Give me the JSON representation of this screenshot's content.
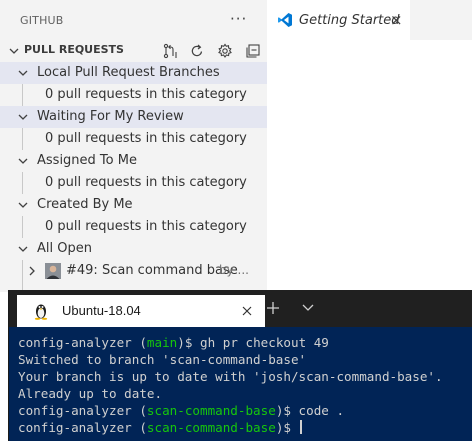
{
  "sidebar": {
    "header": "GITHUB",
    "more_label": "···",
    "section": {
      "title": "PULL REQUESTS",
      "icons": [
        "create-pull-request-icon",
        "refresh-icon",
        "settings-gear-icon",
        "collapse-all-icon"
      ]
    },
    "categories": [
      {
        "label": "Local Pull Request Branches",
        "expanded": true,
        "selected": true,
        "child": "0 pull requests in this category"
      },
      {
        "label": "Waiting For My Review",
        "expanded": true,
        "selected": false,
        "child": "0 pull requests in this category"
      },
      {
        "label": "Assigned To Me",
        "expanded": true,
        "selected": false,
        "child": "0 pull requests in this category"
      },
      {
        "label": "Created By Me",
        "expanded": true,
        "selected": false,
        "child": "0 pull requests in this category"
      },
      {
        "label": "All Open",
        "expanded": true,
        "selected": false
      }
    ],
    "pr_item": {
      "title": "#49: Scan command base",
      "description": "by ..."
    }
  },
  "editor": {
    "tab": {
      "label": "Getting Started",
      "close": "×",
      "icon": "vscode-logo-icon"
    }
  },
  "terminal": {
    "tab_title": "Ubuntu-18.04",
    "tab_icon": "tux-linux-icon",
    "new_tab_label": "+",
    "lines": [
      {
        "before": "config-analyzer (",
        "branch": "main",
        "after": ")$ gh pr checkout 49"
      },
      {
        "text": "Switched to branch 'scan-command-base'"
      },
      {
        "text": "Your branch is up to date with 'josh/scan-command-base'."
      },
      {
        "text": "Already up to date."
      },
      {
        "before": "config-analyzer (",
        "branch": "scan-command-base",
        "after": ")$ code ."
      },
      {
        "before": "config-analyzer (",
        "branch": "scan-command-base",
        "after": ")$ "
      }
    ]
  },
  "colors": {
    "sidebar_bg": "#f3f3f3",
    "selection_bg": "#e4e6f1",
    "terminal_bg": "#012456",
    "prompt_green": "#16c60c",
    "vscode_blue": "#0078d4"
  }
}
